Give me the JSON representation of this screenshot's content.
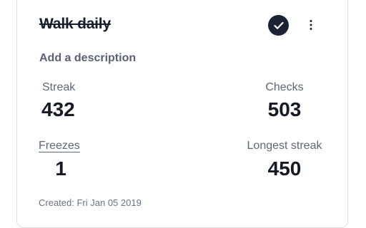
{
  "habit": {
    "title": "Walk daily",
    "completed": true,
    "description_placeholder": "Add a description"
  },
  "stats": {
    "streak": {
      "label": "Streak",
      "value": "432"
    },
    "checks": {
      "label": "Checks",
      "value": "503"
    },
    "freezes": {
      "label": "Freezes",
      "value": "1"
    },
    "longest_streak": {
      "label": "Longest streak",
      "value": "450"
    }
  },
  "footer": {
    "created": "Created: Fri Jan 05 2019"
  },
  "icons": {
    "check": "check-icon",
    "menu": "more-vertical-icon"
  },
  "colors": {
    "check_button_bg": "#1b2234",
    "text_dark": "#161a24",
    "text_muted": "#5f6675"
  }
}
